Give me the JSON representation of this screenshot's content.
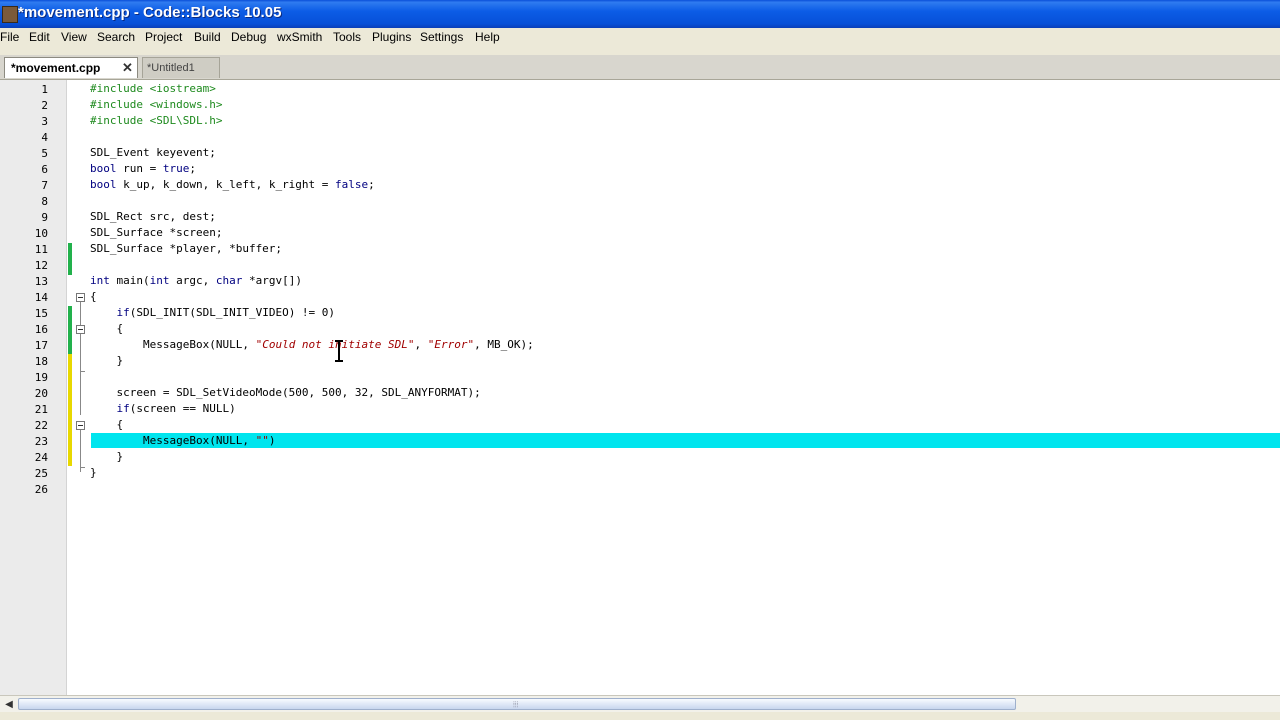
{
  "window": {
    "title": "*movement.cpp - Code::Blocks 10.05"
  },
  "menu": [
    "File",
    "Edit",
    "View",
    "Search",
    "Project",
    "Build",
    "Debug",
    "wxSmith",
    "Tools",
    "Plugins",
    "Settings",
    "Help"
  ],
  "tabs": [
    {
      "label": "*movement.cpp",
      "active": true
    },
    {
      "label": "*Untitled1",
      "active": false
    }
  ],
  "colors": {
    "titlebar": "#0a55e0",
    "current_line_highlight": "#00e5ee",
    "preprocessor": "#1e8a1e",
    "keyword": "#000080",
    "string": "#a00000",
    "change_bar_saved": "#22b14c",
    "change_bar_unsaved": "#e8d800"
  },
  "editor": {
    "lines": [
      {
        "n": "1",
        "segs": [
          [
            "pp",
            "#include <iostream>"
          ]
        ]
      },
      {
        "n": "2",
        "segs": [
          [
            "pp",
            "#include <windows.h>"
          ]
        ]
      },
      {
        "n": "3",
        "segs": [
          [
            "pp",
            "#include <SDL\\SDL.h>"
          ]
        ]
      },
      {
        "n": "4",
        "segs": []
      },
      {
        "n": "5",
        "segs": [
          [
            "tx",
            "SDL_Event keyevent;"
          ]
        ]
      },
      {
        "n": "6",
        "segs": [
          [
            "kw",
            "bool"
          ],
          [
            "tx",
            " run = "
          ],
          [
            "kw",
            "true"
          ],
          [
            "tx",
            ";"
          ]
        ]
      },
      {
        "n": "7",
        "segs": [
          [
            "kw",
            "bool"
          ],
          [
            "tx",
            " k_up, k_down, k_left, k_right = "
          ],
          [
            "kw",
            "false"
          ],
          [
            "tx",
            ";"
          ]
        ]
      },
      {
        "n": "8",
        "segs": []
      },
      {
        "n": "9",
        "segs": [
          [
            "tx",
            "SDL_Rect src, dest;"
          ]
        ]
      },
      {
        "n": "10",
        "segs": [
          [
            "tx",
            "SDL_Surface *screen;"
          ]
        ]
      },
      {
        "n": "11",
        "segs": [
          [
            "tx",
            "SDL_Surface *player, *buffer;"
          ]
        ]
      },
      {
        "n": "12",
        "segs": []
      },
      {
        "n": "13",
        "segs": [
          [
            "kw",
            "int"
          ],
          [
            "tx",
            " main("
          ],
          [
            "kw",
            "int"
          ],
          [
            "tx",
            " argc, "
          ],
          [
            "kw",
            "char"
          ],
          [
            "tx",
            " *argv[])"
          ]
        ]
      },
      {
        "n": "14",
        "segs": [
          [
            "tx",
            "{"
          ]
        ]
      },
      {
        "n": "15",
        "segs": [
          [
            "tx",
            "    "
          ],
          [
            "kw",
            "if"
          ],
          [
            "tx",
            "(SDL_INIT(SDL_INIT_VIDEO) != 0)"
          ]
        ]
      },
      {
        "n": "16",
        "segs": [
          [
            "tx",
            "    {"
          ]
        ]
      },
      {
        "n": "17",
        "segs": [
          [
            "tx",
            "        MessageBox(NULL, "
          ],
          [
            "str",
            "\"Could not initiate SDL\""
          ],
          [
            "tx",
            ", "
          ],
          [
            "str",
            "\"Error\""
          ],
          [
            "tx",
            ", MB_OK);"
          ]
        ]
      },
      {
        "n": "18",
        "segs": [
          [
            "tx",
            "    }"
          ]
        ]
      },
      {
        "n": "19",
        "segs": []
      },
      {
        "n": "20",
        "segs": [
          [
            "tx",
            "    screen = SDL_SetVideoMode(500, 500, 32, SDL_ANYFORMAT);"
          ]
        ]
      },
      {
        "n": "21",
        "segs": [
          [
            "tx",
            "    "
          ],
          [
            "kw",
            "if"
          ],
          [
            "tx",
            "(screen == NULL)"
          ]
        ]
      },
      {
        "n": "22",
        "segs": [
          [
            "tx",
            "    {"
          ]
        ]
      },
      {
        "n": "23",
        "segs": [
          [
            "tx",
            "        MessageBox(NULL, "
          ],
          [
            "str",
            "\"\""
          ],
          [
            "tx",
            ")"
          ]
        ]
      },
      {
        "n": "24",
        "segs": [
          [
            "tx",
            "    }"
          ]
        ]
      },
      {
        "n": "25",
        "segs": [
          [
            "tx",
            "}"
          ]
        ]
      },
      {
        "n": "26",
        "segs": []
      }
    ],
    "current_line": "23"
  }
}
